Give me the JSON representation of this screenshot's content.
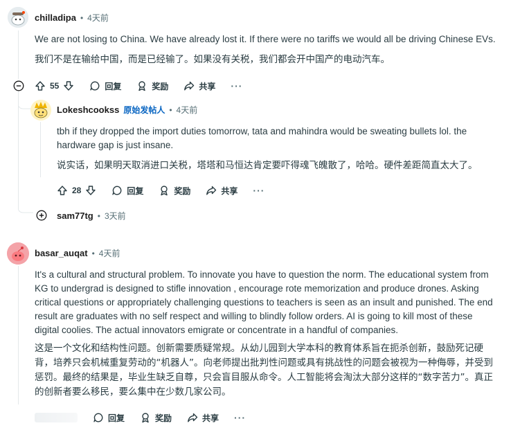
{
  "comments": {
    "c1": {
      "username": "chilladipa",
      "separator": "•",
      "time": "4天前",
      "text_en": "We are not losing to China. We have already lost it. If there were no tariffs we would all be driving Chinese EVs.",
      "text_zh": "我们不是在输给中国，而是已经输了。如果没有关税，我们都会开中国产的电动汽车。",
      "votes": "55",
      "reply_label": "回复",
      "award_label": "奖励",
      "share_label": "共享",
      "more_label": "···"
    },
    "c2": {
      "username": "Lokeshcookss",
      "op_badge": "原始发帖人",
      "separator": "•",
      "time": "4天前",
      "text_en_1": "tbh if they dropped the import duties tomorrow, tata and mahindra would be sweating bullets lol. the",
      "text_en_2": "hardware gap is just insane.",
      "text_zh": "说实话，如果明天取消进口关税，塔塔和马恒达肯定要吓得魂飞魄散了，哈哈。硬件差距简直太大了。",
      "votes": "28",
      "reply_label": "回复",
      "award_label": "奖励",
      "share_label": "共享",
      "more_label": "···"
    },
    "c3": {
      "username": "sam77tg",
      "separator": "•",
      "time": "3天前"
    },
    "c4": {
      "username": "basar_auqat",
      "separator": "•",
      "time": "4天前",
      "text_en": [
        "It's a cultural and structural problem. To innovate you have to question the norm. The educational system from",
        "KG to undergrad is designed to stifle innovation , encourage rote memorization and produce drones. Asking",
        "critical questions or appropriately challenging questions to teachers is seen as an insult and punished. The end",
        "result are graduates with no self respect and willing to blindly follow orders. AI is going to kill most of these",
        "digital coolies. The actual innovators emigrate or concentrate in a handful of companies."
      ],
      "text_zh": [
        "这是一个文化和结构性问题。创新需要质疑常规。从幼儿园到大学本科的教育体系旨在扼杀创新，鼓励死记硬",
        "背，培养只会机械重复劳动的“机器人”。向老师提出批判性问题或具有挑战性的问题会被视为一种侮辱，并受到",
        "惩罚。最终的结果是，毕业生缺乏自尊，只会盲目服从命令。人工智能将会淘汰大部分这样的“数字苦力”。真正",
        "的创新者要么移民，要么集中在少数几家公司。"
      ],
      "reply_label": "回复",
      "award_label": "奖励",
      "share_label": "共享",
      "more_label": "···"
    }
  },
  "colors": {
    "op_badge": "#0a66c2",
    "muted": "#576f76",
    "thread_line": "#e3e8ea",
    "avatar_pink": "#f4a3a8"
  },
  "icons": [
    "collapse-icon",
    "expand-icon",
    "upvote-icon",
    "downvote-icon",
    "reply-icon",
    "award-icon",
    "share-icon",
    "more-icon"
  ]
}
